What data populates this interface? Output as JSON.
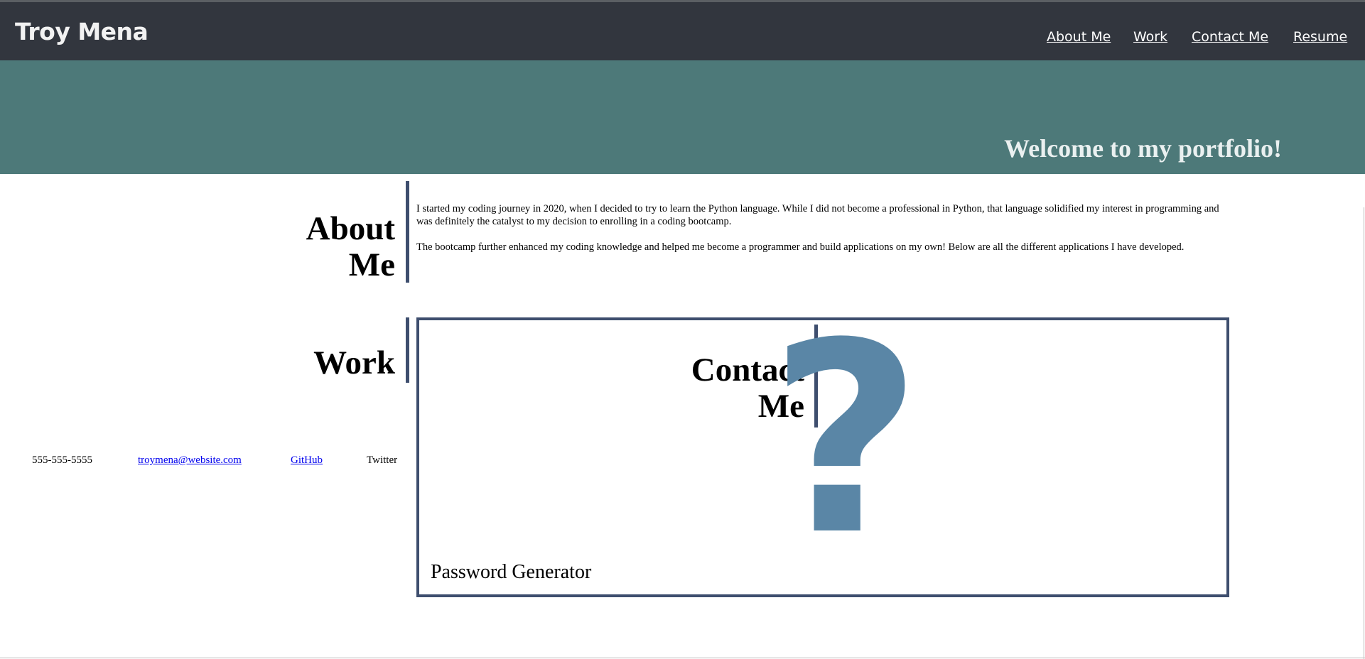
{
  "header": {
    "brand": "Troy Mena",
    "nav": [
      "About Me",
      "Work",
      "Contact Me",
      "Resume"
    ]
  },
  "hero": {
    "title": "Welcome to my portfolio!"
  },
  "about": {
    "heading_line1": "About",
    "heading_line2": "Me",
    "paragraphs": [
      "I started my coding journey in 2020, when I decided to try to learn the Python language. While I did not become a professional in Python, that language solidified my interest in programming and was definitely the catalyst to my decision to enrolling in a coding bootcamp.",
      "The bootcamp further enhanced my coding knowledge and helped me become a programmer and build applications on my own! Below are all the different applications I have developed."
    ]
  },
  "work": {
    "heading": "Work",
    "project_title": "Password Generator",
    "placeholder_icon": "question-mark-icon",
    "placeholder_glyph": "?"
  },
  "contact": {
    "heading_line1": "Contact",
    "heading_line2": "Me",
    "phone": "555-555-5555",
    "email": "troymena@website.com",
    "github": "GitHub",
    "twitter": "Twitter"
  },
  "colors": {
    "navbar": "#32363e",
    "hero": "#4d7979",
    "accent": "#3e4e6e",
    "placeholder": "#5a86a6"
  }
}
